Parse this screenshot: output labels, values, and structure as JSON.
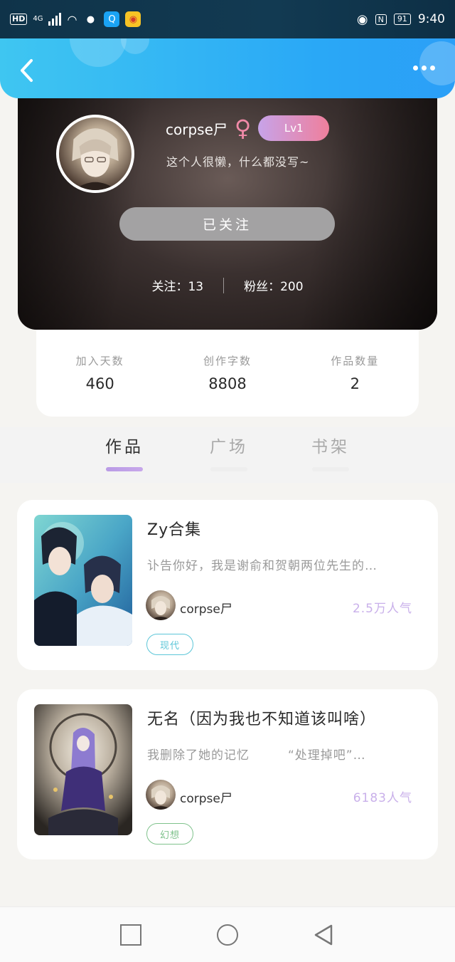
{
  "status_bar": {
    "hd": "HD",
    "network": "4G",
    "battery": "91",
    "time": "9:40"
  },
  "profile": {
    "username": "corpse尸",
    "gender_icon": "female-icon",
    "level": "Lv1",
    "bio": "这个人很懒，什么都没写~",
    "follow_button": "已关注",
    "following_label": "关注：13",
    "fans_label": "粉丝：200"
  },
  "stats": [
    {
      "label": "加入天数",
      "value": "460"
    },
    {
      "label": "创作字数",
      "value": "8808"
    },
    {
      "label": "作品数量",
      "value": "2"
    }
  ],
  "tabs": [
    {
      "label": "作品",
      "active": true
    },
    {
      "label": "广场",
      "active": false
    },
    {
      "label": "书架",
      "active": false
    }
  ],
  "works": [
    {
      "title": "Zy合集",
      "desc": "讣告你好，我是谢俞和贺朝两位先生的…",
      "author": "corpse尸",
      "popularity": "2.5万人气",
      "tag": "现代",
      "tag_color": "#5cc6d8"
    },
    {
      "title": "无名（因为我也不知道该叫啥）",
      "desc": "我删除了她的记忆　　　“处理掉吧”…",
      "author": "corpse尸",
      "popularity": "6183人气",
      "tag": "幻想",
      "tag_color": "#7fc28c"
    }
  ],
  "colors": {
    "header_blue": "#2aa8f6",
    "tab_indicator": "#b99be6",
    "popularity": "#c9b0ea"
  }
}
